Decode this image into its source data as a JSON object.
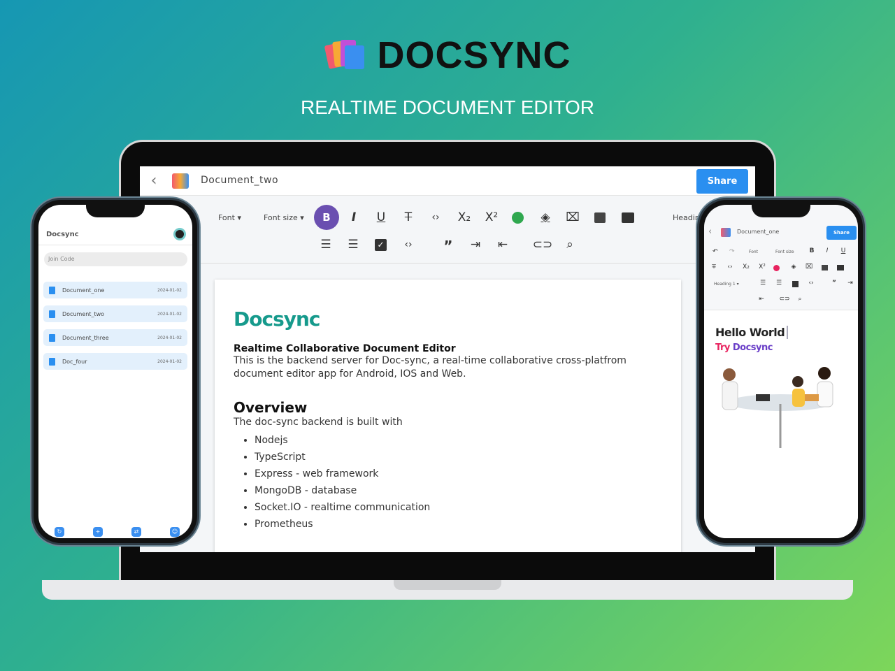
{
  "brand": {
    "name": "DOCSYNC",
    "tagline": "REALTIME DOCUMENT EDITOR"
  },
  "desktop": {
    "doc_title": "Document_two",
    "share_label": "Share",
    "toolbar": {
      "font": "Font",
      "font_size": "Font size",
      "heading": "Headin",
      "row1": [
        "B",
        "I",
        "U",
        "S",
        "<>",
        "X₂",
        "X²",
        "palette",
        "fill",
        "clear",
        "image",
        "video"
      ],
      "row2": [
        "ordered-list",
        "bullet-list",
        "checklist",
        "code-block",
        "quote",
        "indent",
        "outdent",
        "link",
        "search"
      ]
    },
    "content": {
      "title": "Docsync",
      "subtitle": "Realtime Collaborative Document Editor",
      "intro": "This is the backend server for Doc-sync, a real-time collaborative cross-platfrom document editor app for Android, IOS and Web.",
      "overview": "Overview",
      "overview_text": "The doc-sync backend is built with",
      "items": [
        "Nodejs",
        "TypeScript",
        "Express - web framework",
        "MongoDB - database",
        "Socket.IO - realtime communication",
        "Prometheus"
      ]
    }
  },
  "left_phone": {
    "app_title": "Docsync",
    "join_placeholder": "Join Code",
    "documents": [
      {
        "name": "Document_one",
        "date": "2024-01-02"
      },
      {
        "name": "Document_two",
        "date": "2024-01-02"
      },
      {
        "name": "Document_three",
        "date": "2024-01-02"
      },
      {
        "name": "Doc_four",
        "date": "2024-01-02"
      }
    ]
  },
  "right_phone": {
    "doc_title": "Document_one",
    "share_label": "Share",
    "font": "Font",
    "font_size": "Font size",
    "heading": "Heading 1",
    "hello": "Hello World",
    "try_word": "Try",
    "try_brand": "Docsync"
  },
  "colors": {
    "accent": "#2a8ff0",
    "bold_active": "#6a4fb0",
    "title": "#169a8c",
    "palette": "#2fa84f",
    "try": "#e8235f",
    "docsync": "#6a3fc8"
  }
}
